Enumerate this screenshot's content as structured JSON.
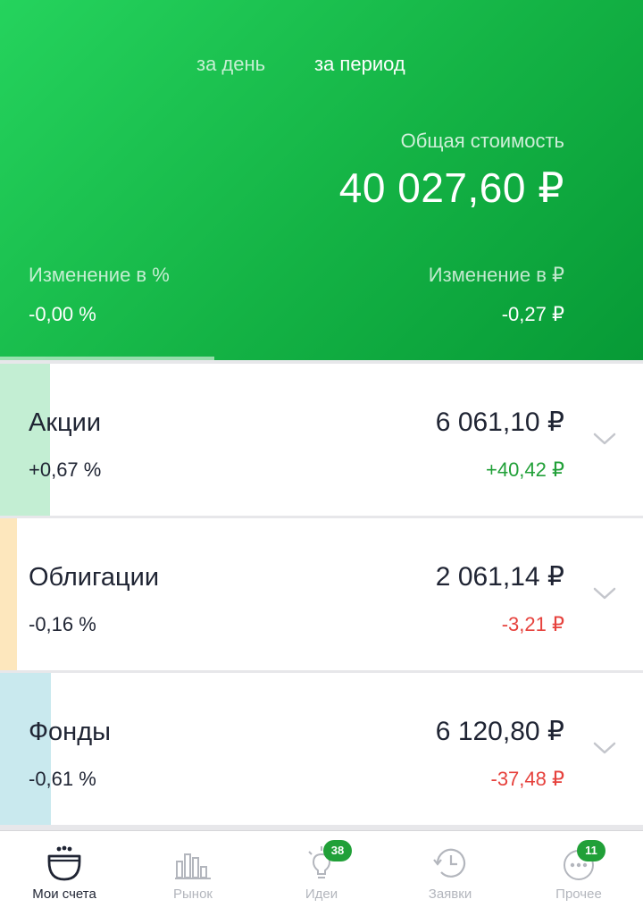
{
  "header": {
    "periods": [
      "за день",
      "за период"
    ],
    "total_label": "Общая стоимость",
    "total_value": "40 027,60 ₽",
    "change_pct_label": "Изменение в  %",
    "change_pct_value": "-0,00  %",
    "change_rub_label": "Изменение в ₽",
    "change_rub_value": "-0,27 ₽"
  },
  "assets": [
    {
      "name": "Акции",
      "pct": "+0,67  %",
      "value": "6 061,10 ₽",
      "delta": "+40,42 ₽",
      "accent": "#c3eed3",
      "delta_color": "#21a038"
    },
    {
      "name": "Облигации",
      "pct": "-0,16  %",
      "value": "2 061,14 ₽",
      "delta": "-3,21 ₽",
      "accent": "#fde7bd",
      "delta_color": "#e6413c"
    },
    {
      "name": "Фонды",
      "pct": "-0,61  %",
      "value": "6 120,80 ₽",
      "delta": "-37,48 ₽",
      "accent": "#c9e9ee",
      "delta_color": "#e6413c"
    }
  ],
  "tabs": [
    {
      "label": "Мои счета",
      "icon": "wallet-icon"
    },
    {
      "label": "Рынок",
      "icon": "bar-chart-icon"
    },
    {
      "label": "Идеи",
      "icon": "lightbulb-icon",
      "badge": "38"
    },
    {
      "label": "Заявки",
      "icon": "history-clock-icon"
    },
    {
      "label": "Прочее",
      "icon": "more-dots-icon",
      "badge": "11"
    }
  ],
  "colors": {
    "brand_green": "#21a038",
    "negative_red": "#e6413c"
  }
}
